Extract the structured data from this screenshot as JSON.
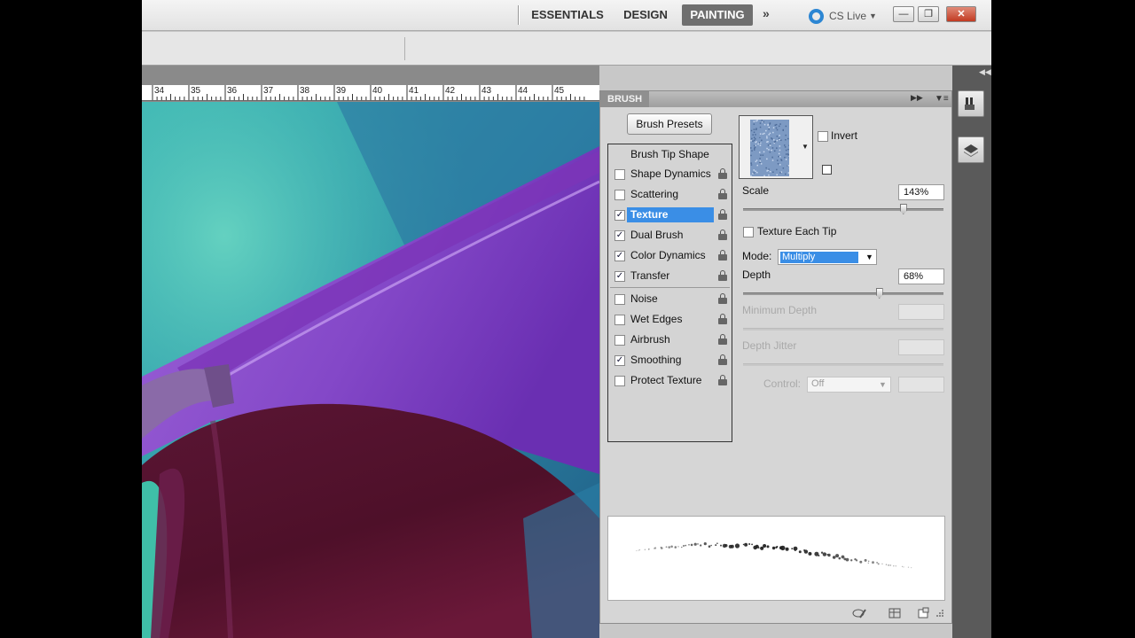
{
  "workspace": {
    "items": [
      {
        "label": "ESSENTIALS",
        "active": false
      },
      {
        "label": "DESIGN",
        "active": false
      },
      {
        "label": "PAINTING",
        "active": true
      }
    ],
    "more_icon": "double-chevron-right-icon",
    "cs_live": "CS Live"
  },
  "window_controls": {
    "minimize": "minimize-icon",
    "restore": "restore-icon",
    "close": "close-icon",
    "close_color": "#c23b22"
  },
  "ruler": {
    "labels": [
      "34",
      "35",
      "36",
      "37",
      "38",
      "39",
      "40",
      "41",
      "42",
      "43",
      "44",
      "45"
    ]
  },
  "brush_panel": {
    "title": "BRUSH",
    "presets_button": "Brush Presets",
    "options": [
      {
        "label": "Brush Tip Shape",
        "header": true
      },
      {
        "label": "Shape Dynamics",
        "checked": false
      },
      {
        "label": "Scattering",
        "checked": false
      },
      {
        "label": "Texture",
        "checked": true,
        "selected": true
      },
      {
        "label": "Dual Brush",
        "checked": true
      },
      {
        "label": "Color Dynamics",
        "checked": true
      },
      {
        "label": "Transfer",
        "checked": true
      },
      {
        "label": "Noise",
        "checked": false
      },
      {
        "label": "Wet Edges",
        "checked": false
      },
      {
        "label": "Airbrush",
        "checked": false
      },
      {
        "label": "Smoothing",
        "checked": true
      },
      {
        "label": "Protect Texture",
        "checked": false
      }
    ],
    "texture": {
      "invert_label": "Invert",
      "invert_checked": false,
      "scale_label": "Scale",
      "scale_value": "143%",
      "scale_fraction": 0.8,
      "texture_each_tip_label": "Texture Each Tip",
      "texture_each_tip_checked": false,
      "mode_label": "Mode:",
      "mode_value": "Multiply",
      "depth_label": "Depth",
      "depth_value": "68%",
      "depth_fraction": 0.68,
      "min_depth_label": "Minimum Depth",
      "depth_jitter_label": "Depth Jitter",
      "control_label": "Control:",
      "control_value": "Off"
    },
    "accent_color": "#3a8ee6"
  }
}
